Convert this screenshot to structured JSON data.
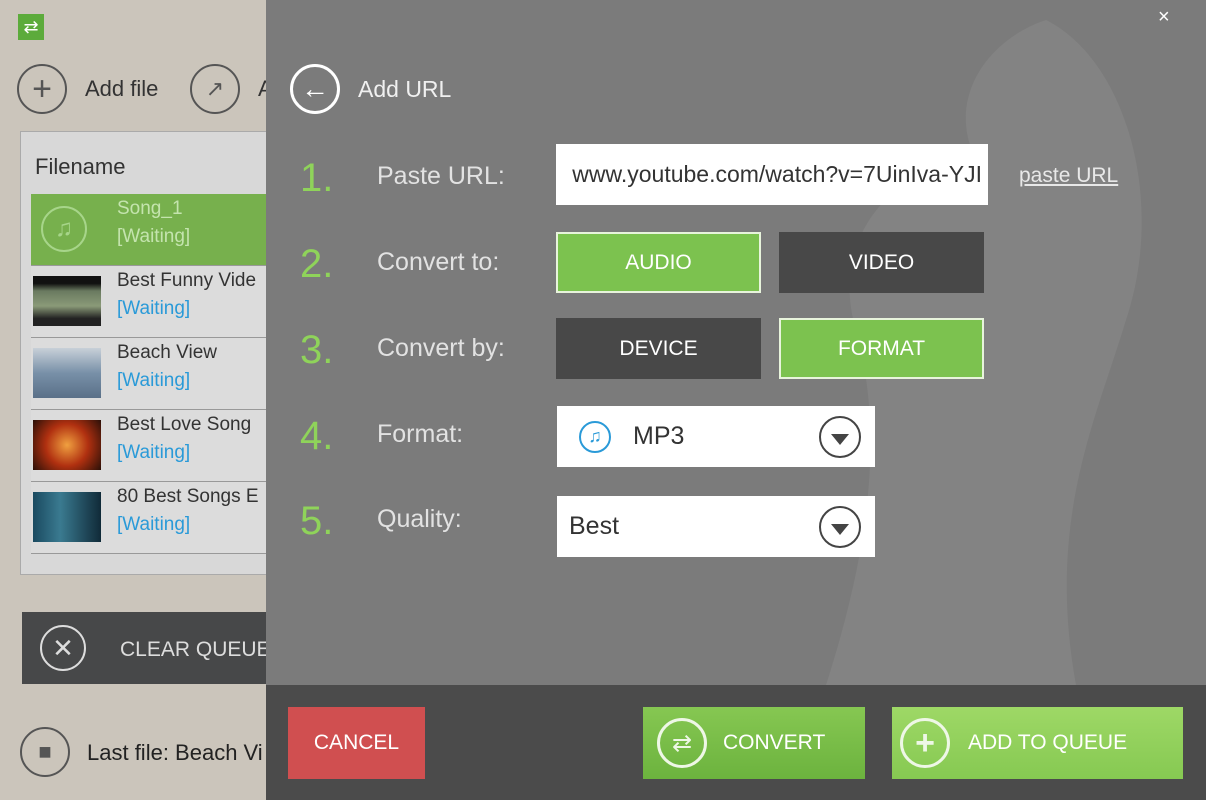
{
  "app": {
    "icon": "convert-icon"
  },
  "toolbar": {
    "add_file": "Add file",
    "second_label": "A"
  },
  "queue": {
    "header": "Filename",
    "items": [
      {
        "name": "Song_1",
        "status": "[Waiting]",
        "selected": true
      },
      {
        "name": "Best Funny Vide",
        "status": "[Waiting]"
      },
      {
        "name": "Beach View",
        "status": "[Waiting]"
      },
      {
        "name": "Best Love Song",
        "status": "[Waiting]"
      },
      {
        "name": "80 Best Songs E",
        "status": "[Waiting]"
      }
    ]
  },
  "clear_queue": "CLEAR QUEUE",
  "last_file": "Last file: Beach Vi",
  "dialog": {
    "title": "Add URL",
    "close": "×",
    "steps": [
      {
        "num": "1.",
        "label": "Paste URL:"
      },
      {
        "num": "2.",
        "label": "Convert to:"
      },
      {
        "num": "3.",
        "label": "Convert by:"
      },
      {
        "num": "4.",
        "label": "Format:"
      },
      {
        "num": "5.",
        "label": "Quality:"
      }
    ],
    "url_value": "www.youtube.com/watch?v=7UinIva-YJI",
    "paste_url": "paste URL",
    "convert_to": {
      "audio": "AUDIO",
      "video": "VIDEO",
      "selected": "AUDIO"
    },
    "convert_by": {
      "device": "DEVICE",
      "format": "FORMAT",
      "selected": "FORMAT"
    },
    "format": "MP3",
    "quality": "Best",
    "cancel": "CANCEL",
    "convert": "CONVERT",
    "add_to_queue": "ADD TO QUEUE"
  },
  "colors": {
    "accent": "#7cc24f",
    "cancel": "#d05050",
    "link": "#2a9ad8"
  }
}
